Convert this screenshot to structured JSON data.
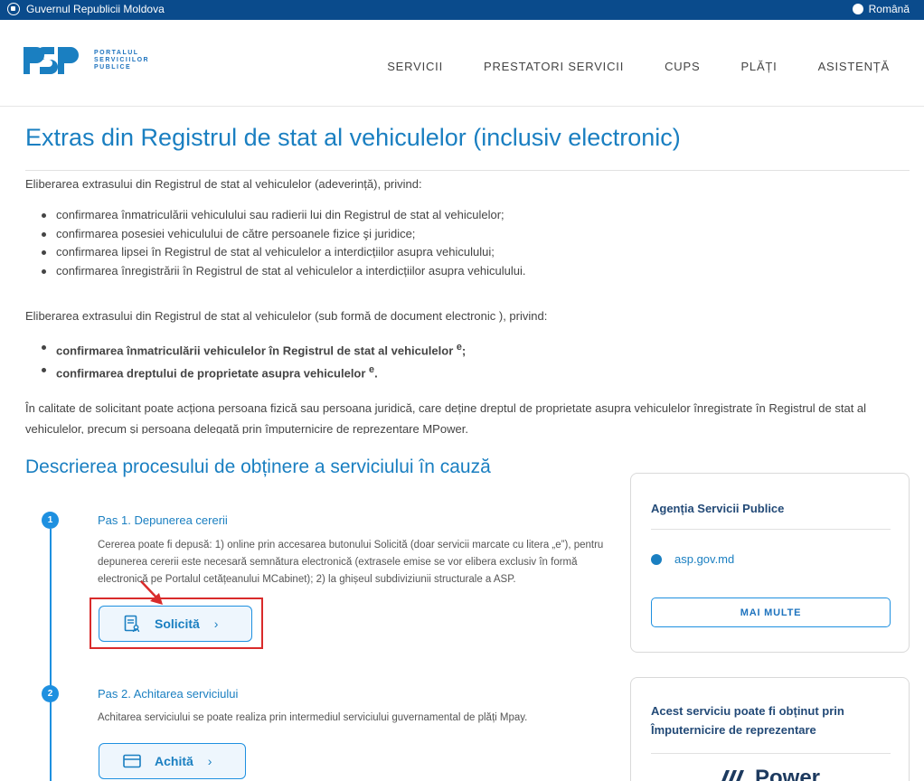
{
  "topbar": {
    "gov_label": "Guvernul Republicii Moldova",
    "lang_label": "Română"
  },
  "logo": {
    "line1": "PORTALUL",
    "line2": "SERVICIILOR",
    "line3": "PUBLICE"
  },
  "nav": [
    "SERVICII",
    "PRESTATORI SERVICII",
    "CUPS",
    "PLĂȚI",
    "ASISTENȚĂ"
  ],
  "page_title": "Extras din Registrul de stat al vehiculelor (inclusiv electronic)",
  "intro1": "Eliberarea extrasului din Registrul de stat al vehiculelor (adeverință), privind:",
  "list1": [
    "confirmarea înmatriculării vehiculului sau radierii lui din Registrul de stat al vehiculelor;",
    "confirmarea posesiei vehiculului de către persoanele fizice şi juridice;",
    "confirmarea lipsei în Registrul de stat al vehiculelor a interdicțiilor asupra vehiculului;",
    "confirmarea înregistrării în Registrul de stat al vehiculelor a interdicțiilor asupra vehiculului."
  ],
  "intro2": "Eliberarea extrasului din Registrul de stat al vehiculelor (sub formă de document electronic ), privind:",
  "list2": [
    {
      "text": "confirmarea înmatriculării vehiculelor în Registrul de stat al vehiculelor ",
      "sup": "e",
      "end": ";"
    },
    {
      "text": "confirmarea dreptului de proprietate asupra vehiculelor ",
      "sup": "e",
      "end": "."
    }
  ],
  "intro3": "În calitate de solicitant poate acționa persoana fizică sau persoana juridică, care deține dreptul de proprietate asupra vehiculelor înregistrate în Registrul de stat al vehiculelor, precum și persoana delegată prin împuternicire de reprezentare MPower.",
  "process_title": "Descrierea procesului de obținere a serviciului în cauză",
  "steps": [
    {
      "number": "1",
      "title": "Pas 1. Depunerea cererii",
      "desc": "Cererea poate fi depusă: 1) online prin accesarea butonului Solicită (doar servicii marcate cu litera „e”), pentru depunerea cererii este necesară semnătura electronică (extrasele emise se vor elibera exclusiv în formă electronică pe Portalul cetățeanului MCabinet); 2) la ghișeul subdiviziunii structurale a ASP.",
      "button": "Solicită",
      "chevron": "›"
    },
    {
      "number": "2",
      "title": "Pas 2. Achitarea serviciului",
      "desc": "Achitarea serviciului se poate realiza prin intermediul serviciului guvernamental de plăți Mpay.",
      "button": "Achită",
      "chevron": "›"
    }
  ],
  "card1": {
    "title": "Agenția Servicii Publice",
    "link": "asp.gov.md",
    "button": "MAI MULTE"
  },
  "card2": {
    "title": "Acest serviciu poate fi obținut prin Împuternicire de reprezentare",
    "logo_word": "Power"
  },
  "colors": {
    "brand_blue": "#1a7fc1",
    "topbar": "#0a4b8c",
    "highlight_red": "#d92b2b"
  }
}
